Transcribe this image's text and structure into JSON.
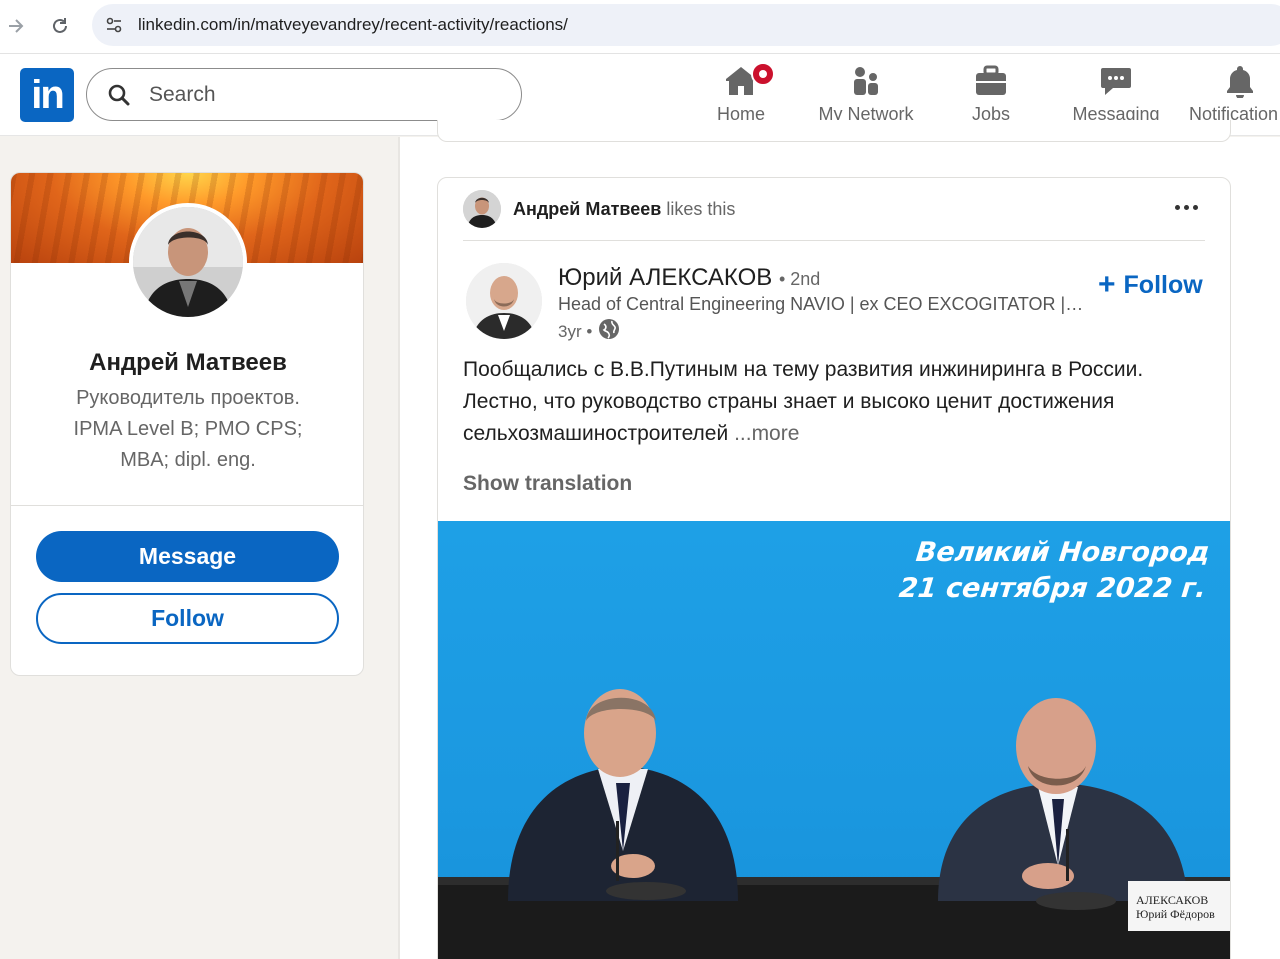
{
  "browser": {
    "url": "linkedin.com/in/matveyevandrey/recent-activity/reactions/"
  },
  "header": {
    "logo_text": "in",
    "search_placeholder": "Search",
    "nav": [
      {
        "label": "Home",
        "icon": "home-icon"
      },
      {
        "label": "My Network",
        "icon": "people-icon"
      },
      {
        "label": "Jobs",
        "icon": "briefcase-icon"
      },
      {
        "label": "Messaging",
        "icon": "chat-icon"
      },
      {
        "label": "Notification",
        "icon": "bell-icon"
      }
    ]
  },
  "profile": {
    "name": "Андрей Матвеев",
    "headline": "Руководитель проектов. IPMA Level B; PMO CPS; MBA; dipl. eng.",
    "message_label": "Message",
    "follow_label": "Follow"
  },
  "post": {
    "actor_name": "Андрей Матвеев",
    "action_text": "likes this",
    "author_name": "Юрий АЛЕКСАКОВ",
    "author_degree": "• 2nd",
    "author_headline": "Head of Central Engineering NAVIO | ex CEO EXCOGITATOR | e...",
    "time_ago": "3yr •",
    "follow_label": "Follow",
    "text": "Пообщались с В.В.Путиным на тему развития инжиниринга в России. Лестно, что руководство страны знает и высоко ценит достижения сельхозмашиностроителей",
    "more_label": "...more",
    "show_translation_label": "Show translation",
    "image_caption_line1": "Великий Новгород",
    "image_caption_line2": "21 сентября 2022 г.",
    "nameplate_line1": "АЛЕКСАКОВ",
    "nameplate_line2": "Юрий Фёдоров"
  },
  "colors": {
    "brand": "#0a66c2",
    "badge": "#cb112d",
    "image_bg": "#1ea0e6"
  }
}
